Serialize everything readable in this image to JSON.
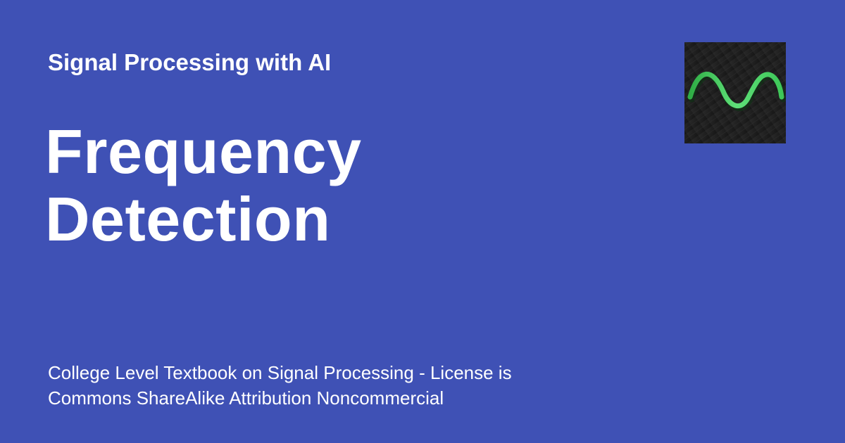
{
  "site_name": "Signal Processing with AI",
  "page_title": {
    "line1": "Frequency",
    "line2": "Detection"
  },
  "description": {
    "line1": "College Level Textbook on Signal Processing - License is",
    "line2": "Commons ShareAlike Attribution Noncommercial"
  },
  "logo": {
    "icon": "sine-wave-icon",
    "wave_color": "#4cd964",
    "background_color": "#1e1e1e"
  },
  "colors": {
    "background": "#3f51b5",
    "text": "#ffffff"
  }
}
